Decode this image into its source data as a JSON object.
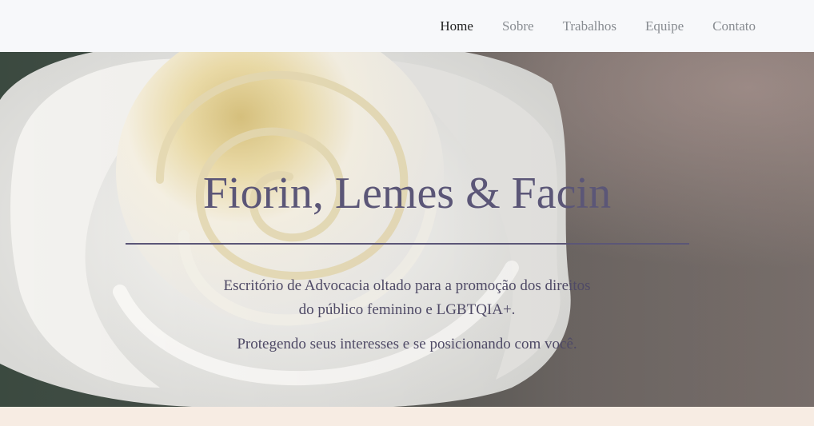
{
  "nav": {
    "items": [
      {
        "label": "Home",
        "active": true
      },
      {
        "label": "Sobre",
        "active": false
      },
      {
        "label": "Trabalhos",
        "active": false
      },
      {
        "label": "Equipe",
        "active": false
      },
      {
        "label": "Contato",
        "active": false
      }
    ]
  },
  "hero": {
    "title": "Fiorin, Lemes & Facin",
    "description_line1": "Escritório de Advocacia oltado para a promoção dos direitos",
    "description_line2": "do público feminino e LGBTQIA+.",
    "tagline": "Protegendo seus interesses e se posicionando com você.",
    "background_image": "white-rose-photo"
  },
  "colors": {
    "nav_background": "#f7f8fa",
    "nav_active": "#1f1f1f",
    "nav_inactive": "#888c91",
    "hero_text": "#5b5677",
    "page_background": "#f7ece3"
  }
}
